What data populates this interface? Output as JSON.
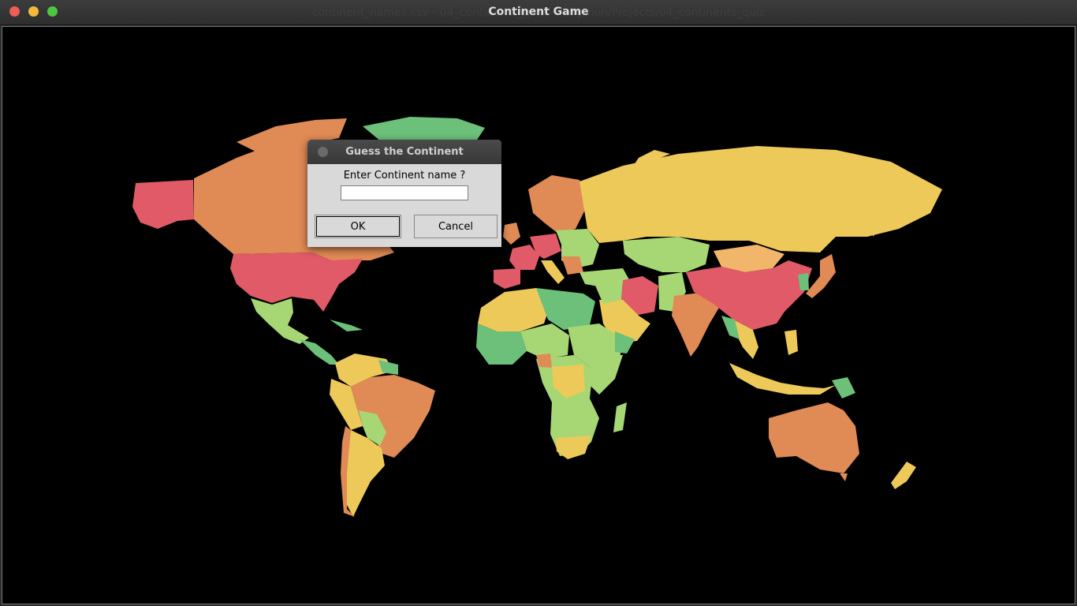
{
  "window": {
    "title": "Continent Game",
    "background_title": "continent_names.csv - 04_continents_quiz - ~/Python/Projects/04_continents_quiz"
  },
  "dialog": {
    "title": "Guess the Continent",
    "prompt": "Enter Continent name ?",
    "input_value": "",
    "ok_label": "OK",
    "cancel_label": "Cancel"
  },
  "map": {
    "palette": {
      "red": "#e05a67",
      "orange": "#e08a55",
      "yellow": "#edc95a",
      "light_green": "#a6d774",
      "green": "#6cc07a",
      "light_orange": "#f2b66a"
    }
  }
}
